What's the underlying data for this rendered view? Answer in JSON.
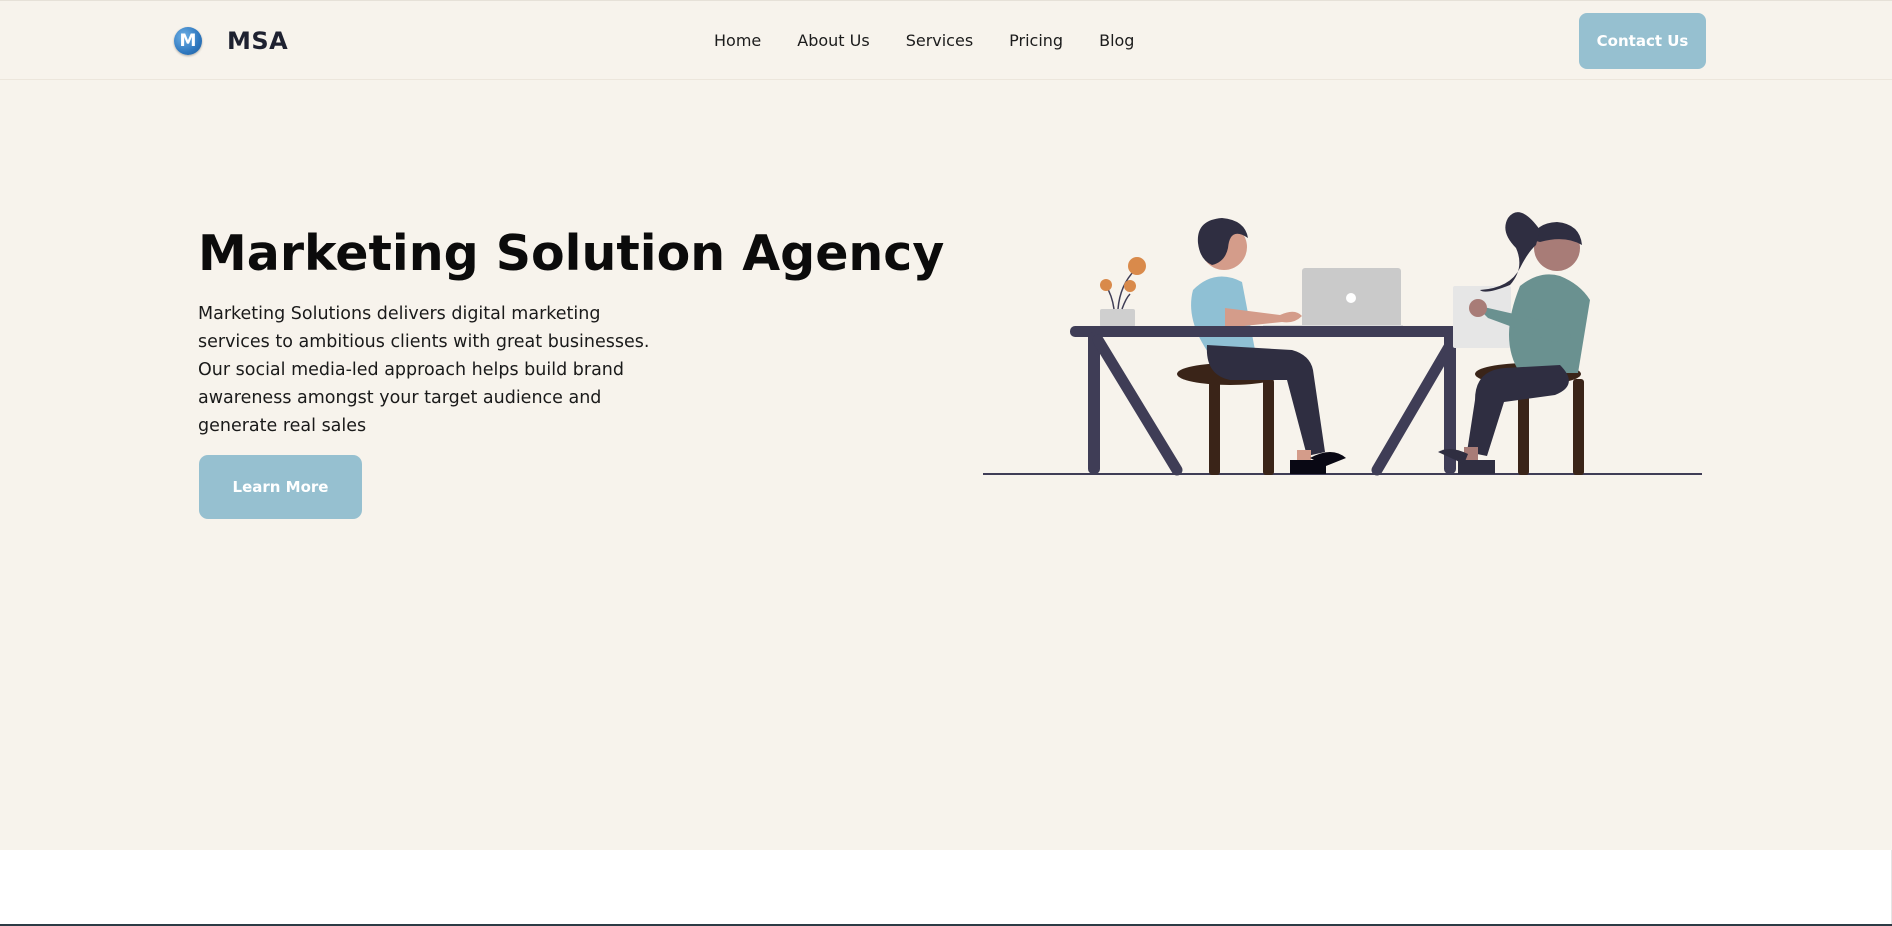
{
  "brand": {
    "logo_letter": "M",
    "name": "MSA"
  },
  "nav": {
    "items": [
      {
        "label": "Home"
      },
      {
        "label": "About Us"
      },
      {
        "label": "Services"
      },
      {
        "label": "Pricing"
      },
      {
        "label": "Blog"
      }
    ],
    "contact_label": "Contact Us"
  },
  "hero": {
    "title": "Marketing Solution Agency",
    "description": "Marketing Solutions delivers digital marketing services to ambitious clients with great businesses. Our social media-led approach helps build brand awareness amongst your target audience and generate real sales",
    "cta_label": "Learn More"
  },
  "colors": {
    "background": "#f7f3ec",
    "accent": "#96c0d0",
    "text": "#0b0b0b",
    "illustration_dark": "#3f3d56"
  }
}
